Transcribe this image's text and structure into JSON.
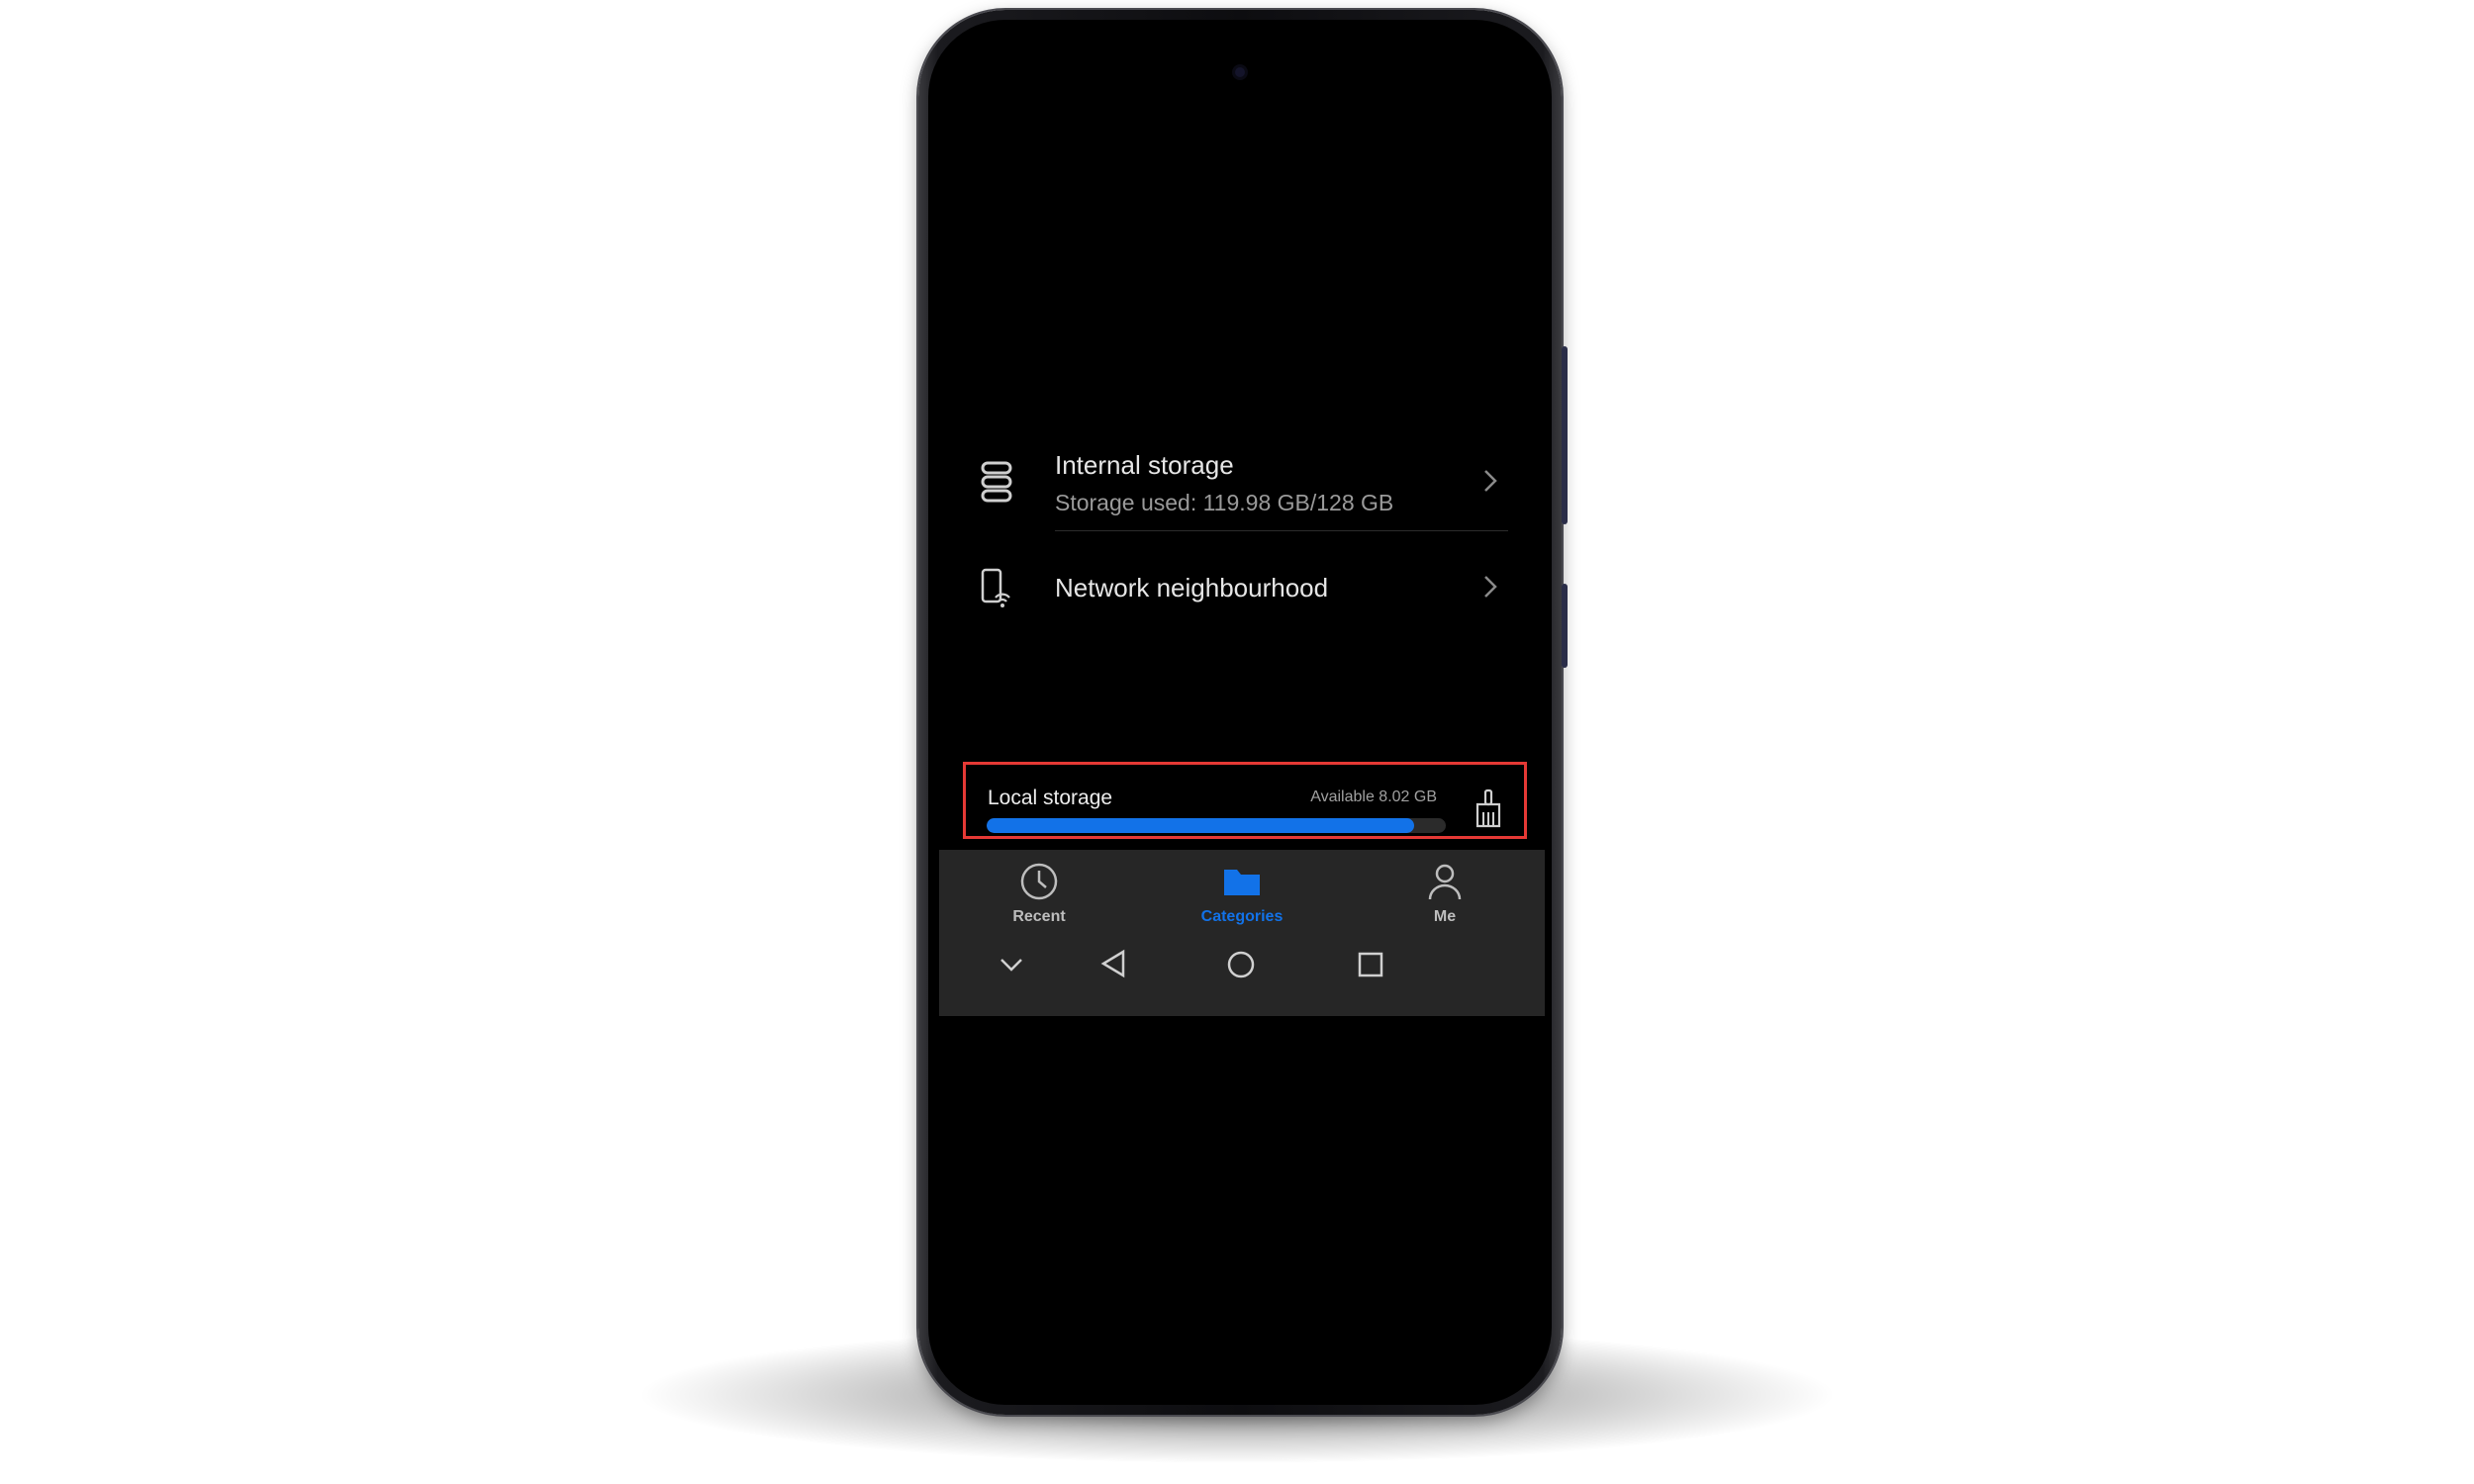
{
  "colors": {
    "accent": "#1272e8",
    "highlight_border": "#e53935",
    "screen_bg": "#000000",
    "nav_bg": "#262626",
    "text_primary": "#e6e6e6",
    "text_secondary": "#9a9a9a"
  },
  "storage_list": {
    "items": [
      {
        "icon": "storage-icon",
        "title": "Internal storage",
        "subtitle": "Storage used: 119.98 GB/128 GB"
      },
      {
        "icon": "network-device-icon",
        "title": "Network neighbourhood"
      }
    ]
  },
  "local_storage": {
    "label": "Local storage",
    "available": "Available 8.02 GB",
    "used_fraction": 0.93,
    "icon": "clean-brush-icon"
  },
  "tabs": [
    {
      "label": "Recent",
      "icon": "clock-icon",
      "active": false
    },
    {
      "label": "Categories",
      "icon": "folder-icon",
      "active": true
    },
    {
      "label": "Me",
      "icon": "person-icon",
      "active": false
    }
  ],
  "system_nav": [
    "chevron-down-icon",
    "back-icon",
    "home-icon",
    "recents-icon"
  ]
}
